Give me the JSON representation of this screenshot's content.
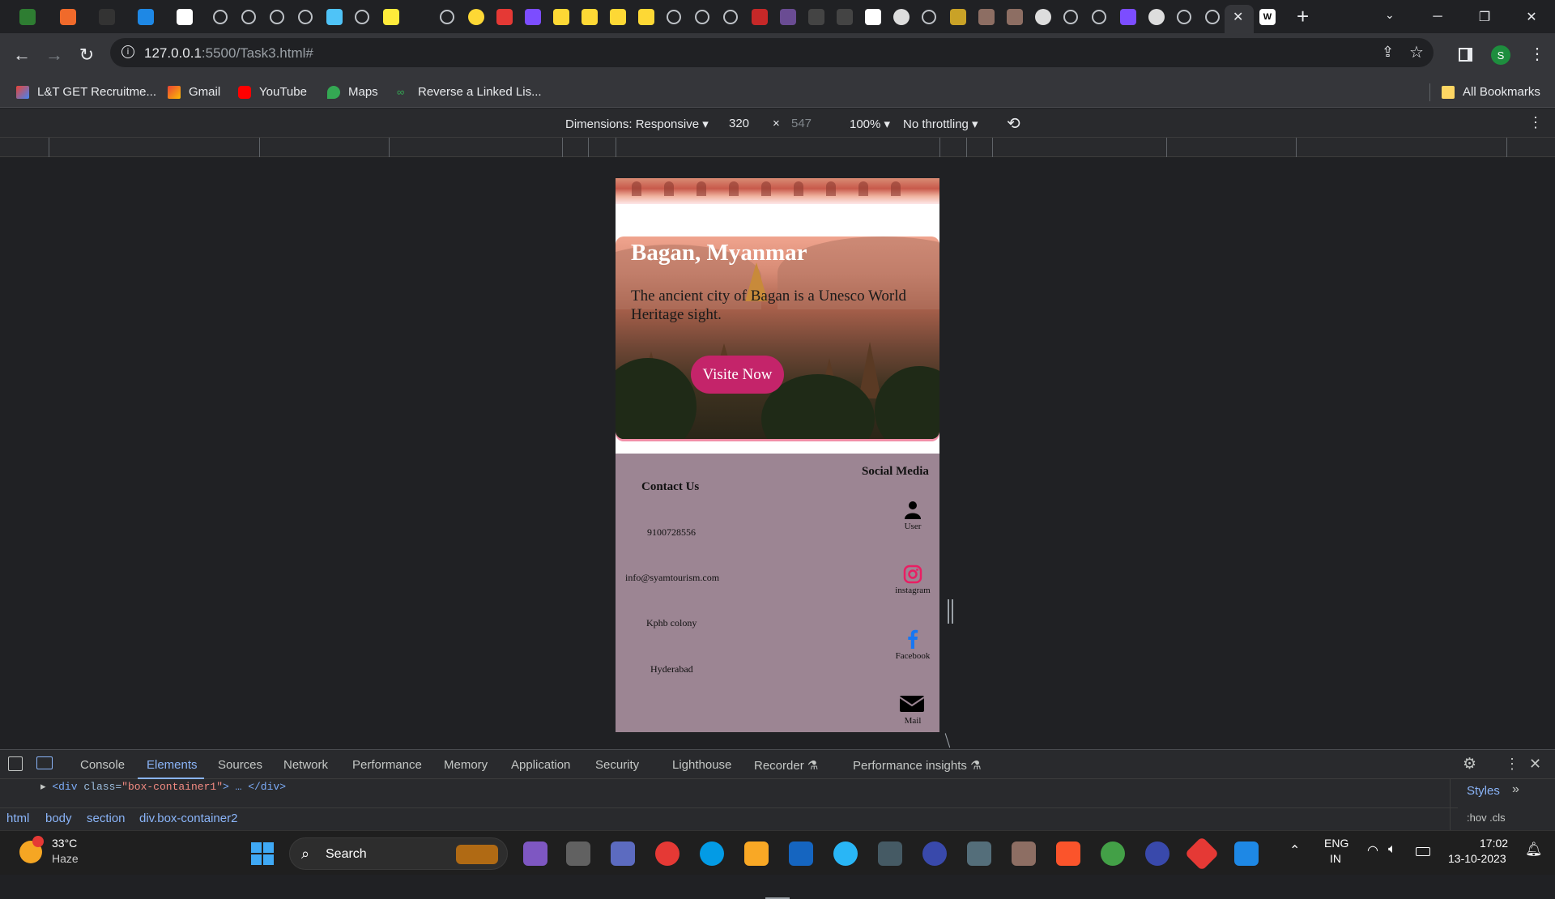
{
  "browser": {
    "address": {
      "host": "127.0.0.1",
      "rest": ":5500/Task3.html#"
    },
    "bookmarks": [
      {
        "label": "L&T GET Recruitme..."
      },
      {
        "label": "Gmail"
      },
      {
        "label": "YouTube"
      },
      {
        "label": "Maps"
      },
      {
        "label": "Reverse a Linked Lis..."
      }
    ],
    "all_bookmarks": "All Bookmarks",
    "profile_initial": "S"
  },
  "device_toolbar": {
    "dimensions": "Dimensions: Responsive ▾",
    "width": "320",
    "times": "×",
    "height": "547",
    "zoom": "100% ▾",
    "throttling": "No throttling ▾"
  },
  "page": {
    "hero": {
      "title": "Bagan, Myanmar",
      "text": "The ancient city of Bagan is a Unesco World Heritage sight.",
      "button": "Visite Now"
    },
    "footer": {
      "contact_title": "Contact Us",
      "contact": [
        "9100728556",
        "info@syamtourism.com",
        "Kphb colony",
        "Hyderabad"
      ],
      "social_title": "Social Media",
      "social": [
        {
          "label": "User",
          "icon": "user-icon"
        },
        {
          "label": "instagram",
          "icon": "instagram-icon"
        },
        {
          "label": "Facebook",
          "icon": "facebook-icon"
        },
        {
          "label": "Mail",
          "icon": "mail-icon"
        }
      ]
    }
  },
  "devtools": {
    "tabs": [
      "Console",
      "Elements",
      "Sources",
      "Network",
      "Performance",
      "Memory",
      "Application",
      "Security",
      "Lighthouse",
      "Recorder ⚗",
      "Performance insights ⚗"
    ],
    "active_tab": "Elements",
    "dom_line": {
      "tag_open": "<div",
      "attr": "class=",
      "val": "\"box-container1\"",
      "tag_close": "> … </div>"
    },
    "breadcrumbs": [
      "html",
      "body",
      "section",
      "div.box-container2"
    ],
    "styles_tab": "Styles",
    "styles_filter": ":hov  .cls"
  },
  "taskbar": {
    "weather_temp": "33°C",
    "weather_desc": "Haze",
    "search": "Search",
    "lang": "ENG",
    "region": "IN",
    "time": "17:02",
    "date": "13-10-2023"
  }
}
